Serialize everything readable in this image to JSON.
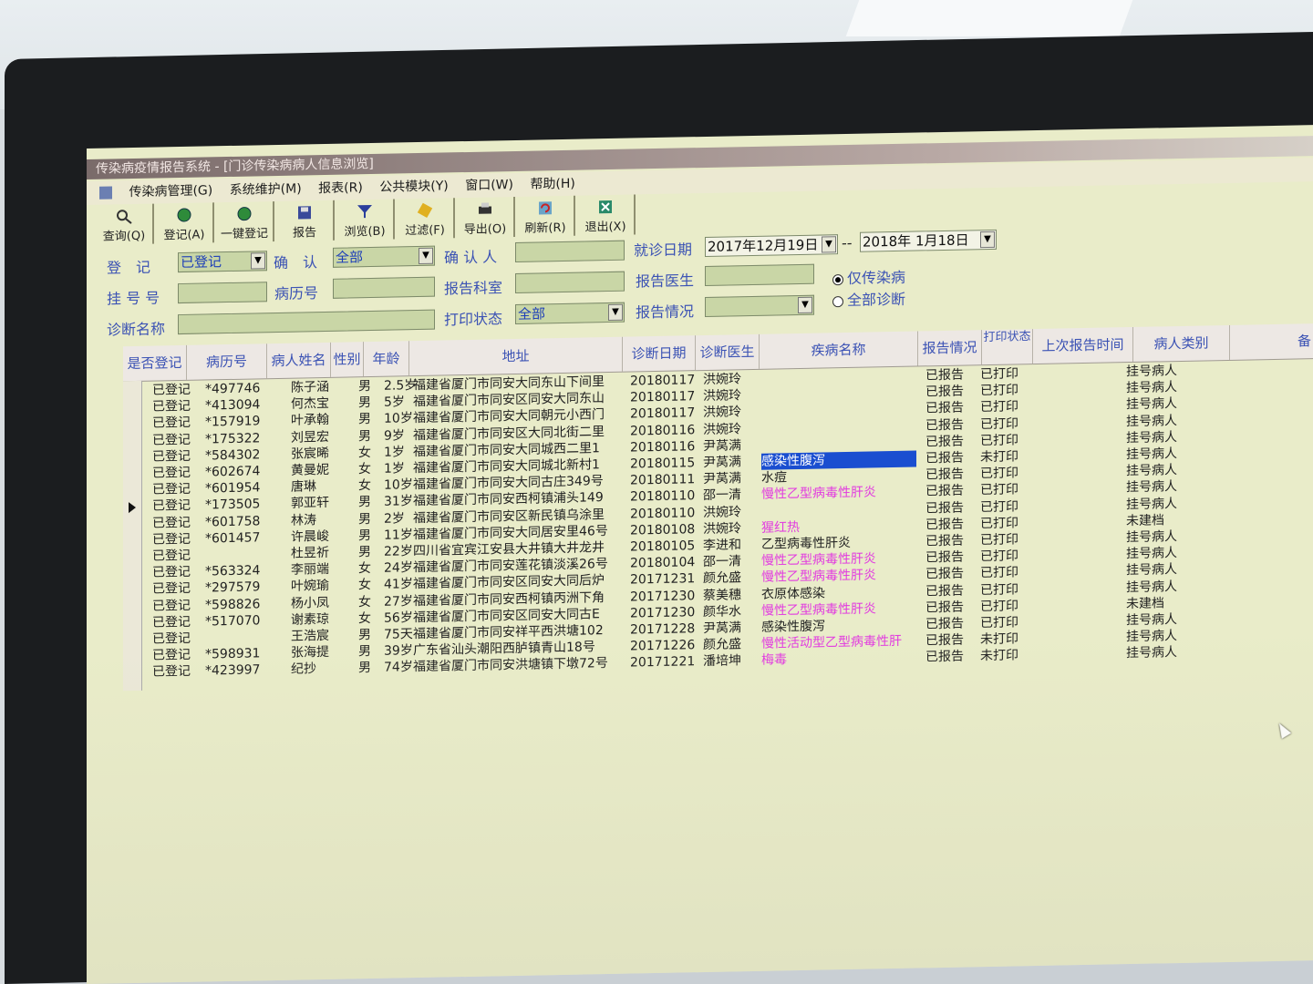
{
  "window": {
    "title": "传染病疫情报告系统 - [门诊传染病病人信息浏览]"
  },
  "menu": [
    "传染病管理(G)",
    "系统维护(M)",
    "报表(R)",
    "公共模块(Y)",
    "窗口(W)",
    "帮助(H)"
  ],
  "toolbar": [
    {
      "label": "查询(Q)",
      "icon": "search-icon"
    },
    {
      "label": "登记(A)",
      "icon": "globe-icon"
    },
    {
      "label": "一键登记",
      "icon": "globe-icon"
    },
    {
      "label": "报告",
      "icon": "disk-icon"
    },
    {
      "label": "浏览(B)",
      "icon": "funnel-icon"
    },
    {
      "label": "过滤(F)",
      "icon": "filter-icon"
    },
    {
      "label": "导出(O)",
      "icon": "printer-icon"
    },
    {
      "label": "刷新(R)",
      "icon": "refresh-icon"
    },
    {
      "label": "退出(X)",
      "icon": "exit-icon"
    }
  ],
  "filters": {
    "register_label": "登　记",
    "register_value": "已登记",
    "confirm_label": "确　认",
    "confirm_value": "全部",
    "confirmer_label": "确 认 人",
    "confirmer_value": "",
    "visit_date_label": "就诊日期",
    "visit_date_from": "2017年12月19日",
    "visit_date_sep": "--",
    "visit_date_to": "2018年 1月18日",
    "reg_no_label": "挂 号 号",
    "reg_no_value": "",
    "record_no_label": "病历号",
    "record_no_value": "",
    "dept_label": "报告科室",
    "dept_value": "",
    "doctor_label": "报告医生",
    "doctor_value": "",
    "diag_label": "诊断名称",
    "diag_value": "",
    "print_label": "打印状态",
    "print_value": "全部",
    "report_label": "报告情况",
    "report_value": "",
    "radio_infectious": "仅传染病",
    "radio_all": "全部诊断"
  },
  "table": {
    "columns": [
      "是否登记",
      "病历号",
      "病人姓名",
      "性别",
      "年龄",
      "地址",
      "诊断日期",
      "诊断医生",
      "疾病名称",
      "报告情况",
      "打印状态",
      "上次报告时间",
      "病人类别",
      "备"
    ],
    "rows": [
      [
        "已登记",
        "*497746",
        "陈子涵",
        "男",
        "2.5岁",
        "福建省厦门市同安大同东山下间里",
        "20180117",
        "洪婉玲",
        "",
        "已报告",
        "已打印",
        "",
        "挂号病人"
      ],
      [
        "已登记",
        "*413094",
        "何杰宝",
        "男",
        "5岁",
        "福建省厦门市同安区同安大同东山",
        "20180117",
        "洪婉玲",
        "",
        "已报告",
        "已打印",
        "",
        "挂号病人"
      ],
      [
        "已登记",
        "*157919",
        "叶承翰",
        "男",
        "10岁",
        "福建省厦门市同安大同朝元小西门",
        "20180117",
        "洪婉玲",
        "",
        "已报告",
        "已打印",
        "",
        "挂号病人"
      ],
      [
        "已登记",
        "*175322",
        "刘昱宏",
        "男",
        "9岁",
        "福建省厦门市同安区大同北街二里",
        "20180116",
        "洪婉玲",
        "",
        "已报告",
        "已打印",
        "",
        "挂号病人"
      ],
      [
        "已登记",
        "*584302",
        "张宸晞",
        "女",
        "1岁",
        "福建省厦门市同安大同城西二里1",
        "20180116",
        "尹莴满",
        "",
        "已报告",
        "已打印",
        "",
        "挂号病人"
      ],
      [
        "已登记",
        "*602674",
        "黄曼妮",
        "女",
        "1岁",
        "福建省厦门市同安大同城北新村1",
        "20180115",
        "尹莴满",
        "感染性腹泻",
        "已报告",
        "未打印",
        "",
        "挂号病人"
      ],
      [
        "已登记",
        "*601954",
        "唐琳",
        "女",
        "10岁",
        "福建省厦门市同安大同古庄349号",
        "20180111",
        "尹莴满",
        "水痘",
        "已报告",
        "已打印",
        "",
        "挂号病人"
      ],
      [
        "已登记",
        "*173505",
        "郭亚轩",
        "男",
        "31岁",
        "福建省厦门市同安西柯镇浦头149",
        "20180110",
        "邵一清",
        "慢性乙型病毒性肝炎",
        "已报告",
        "已打印",
        "",
        "挂号病人"
      ],
      [
        "已登记",
        "*601758",
        "林涛",
        "男",
        "2岁",
        "福建省厦门市同安区新民镇乌涂里",
        "20180110",
        "洪婉玲",
        "",
        "已报告",
        "已打印",
        "",
        "挂号病人"
      ],
      [
        "已登记",
        "*601457",
        "许晨峻",
        "男",
        "11岁",
        "福建省厦门市同安大同居安里46号",
        "20180108",
        "洪婉玲",
        "猩红热",
        "已报告",
        "已打印",
        "",
        "未建档"
      ],
      [
        "已登记",
        "",
        "杜昱祈",
        "男",
        "22岁",
        "四川省宜宾江安县大井镇大井龙井",
        "20180105",
        "李进和",
        "乙型病毒性肝炎",
        "已报告",
        "已打印",
        "",
        "挂号病人"
      ],
      [
        "已登记",
        "*563324",
        "李丽端",
        "女",
        "24岁",
        "福建省厦门市同安莲花镇淡溪26号",
        "20180104",
        "邵一清",
        "慢性乙型病毒性肝炎",
        "已报告",
        "已打印",
        "",
        "挂号病人"
      ],
      [
        "已登记",
        "*297579",
        "叶婉瑜",
        "女",
        "41岁",
        "福建省厦门市同安区同安大同后炉",
        "20171231",
        "颜允盛",
        "慢性乙型病毒性肝炎",
        "已报告",
        "已打印",
        "",
        "挂号病人"
      ],
      [
        "已登记",
        "*598826",
        "杨小凤",
        "女",
        "27岁",
        "福建省厦门市同安西柯镇丙洲下角",
        "20171230",
        "蔡美穗",
        "衣原体感染",
        "已报告",
        "已打印",
        "",
        "挂号病人"
      ],
      [
        "已登记",
        "*517070",
        "谢素琼",
        "女",
        "56岁",
        "福建省厦门市同安区同安大同古E",
        "20171230",
        "颜华水",
        "慢性乙型病毒性肝炎",
        "已报告",
        "已打印",
        "",
        "未建档"
      ],
      [
        "已登记",
        "",
        "王浩宸",
        "男",
        "75天",
        "福建省厦门市同安祥平西洪塘102",
        "20171228",
        "尹莴满",
        "感染性腹泻",
        "已报告",
        "已打印",
        "",
        "挂号病人"
      ],
      [
        "已登记",
        "*598931",
        "张海提",
        "男",
        "39岁",
        "广东省汕头潮阳西胪镇青山18号",
        "20171226",
        "颜允盛",
        "慢性活动型乙型病毒性肝",
        "已报告",
        "未打印",
        "",
        "挂号病人"
      ],
      [
        "已登记",
        "*423997",
        "纪抄",
        "男",
        "74岁",
        "福建省厦门市同安洪塘镇下墩72号",
        "20171221",
        "潘培坤",
        "梅毒",
        "已报告",
        "未打印",
        "",
        "挂号病人"
      ]
    ],
    "selected_row": 5,
    "highlight_color": "#1a4ed0",
    "magenta_color": "#e23be0"
  }
}
